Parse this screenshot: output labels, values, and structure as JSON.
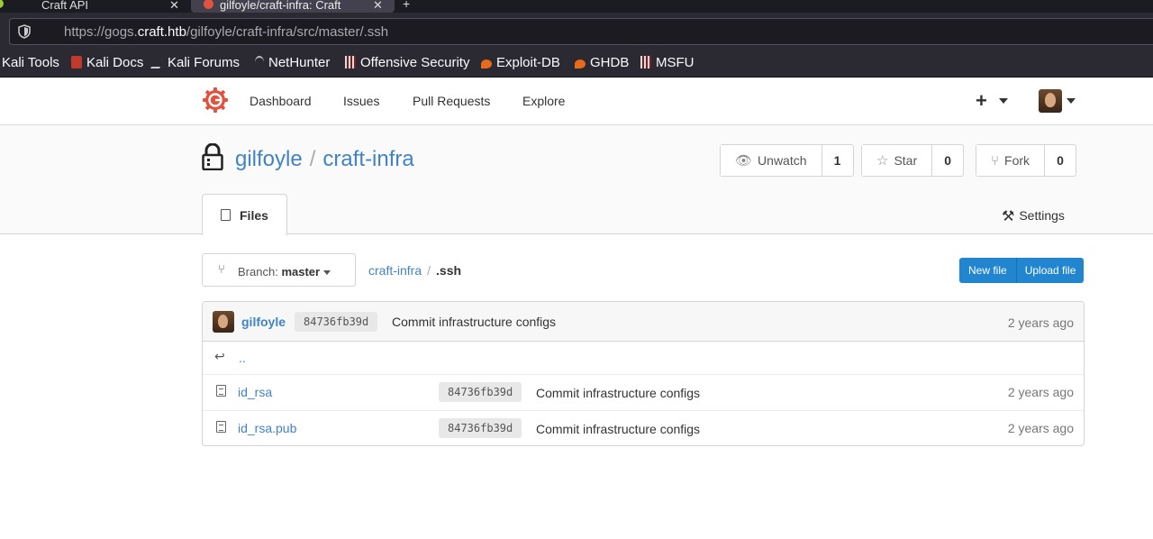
{
  "browser": {
    "tabs": [
      {
        "title": "Craft API"
      },
      {
        "title": "gilfoyle/craft-infra: Craft"
      }
    ],
    "url_prefix": "https://gogs.",
    "url_domain": "craft.htb",
    "url_path": "/gilfoyle/craft-infra/src/master/.ssh",
    "bookmarks": [
      "Kali Tools",
      "Kali Docs",
      "Kali Forums",
      "NetHunter",
      "Offensive Security",
      "Exploit-DB",
      "GHDB",
      "MSFU"
    ]
  },
  "gogs_nav": {
    "items": [
      "Dashboard",
      "Issues",
      "Pull Requests",
      "Explore"
    ],
    "plus": "+"
  },
  "repo": {
    "owner": "gilfoyle",
    "separator": "/",
    "name": "craft-infra",
    "unwatch_label": "Unwatch",
    "watch_count": "1",
    "star_label": "Star",
    "star_count": "0",
    "fork_label": "Fork",
    "fork_count": "0",
    "tab_files": "Files",
    "settings_label": "Settings"
  },
  "browser_bar": {
    "branch_prefix": "Branch:",
    "branch": "master",
    "crumb_root": "craft-infra",
    "crumb_sep": "/",
    "crumb_current": ".ssh",
    "new_file": "New file",
    "upload_file": "Upload file"
  },
  "latest_commit": {
    "author": "gilfoyle",
    "sha": "84736fb39d",
    "message": "Commit infrastructure configs",
    "age": "2 years ago"
  },
  "parent_dir": "..",
  "files": [
    {
      "name": "id_rsa",
      "sha": "84736fb39d",
      "message": "Commit infrastructure configs",
      "age": "2 years ago"
    },
    {
      "name": "id_rsa.pub",
      "sha": "84736fb39d",
      "message": "Commit infrastructure configs",
      "age": "2 years ago"
    }
  ],
  "colors": {
    "link": "#4183c4",
    "primary_button": "#2185d0",
    "gogs_logo": "#e0533f"
  }
}
